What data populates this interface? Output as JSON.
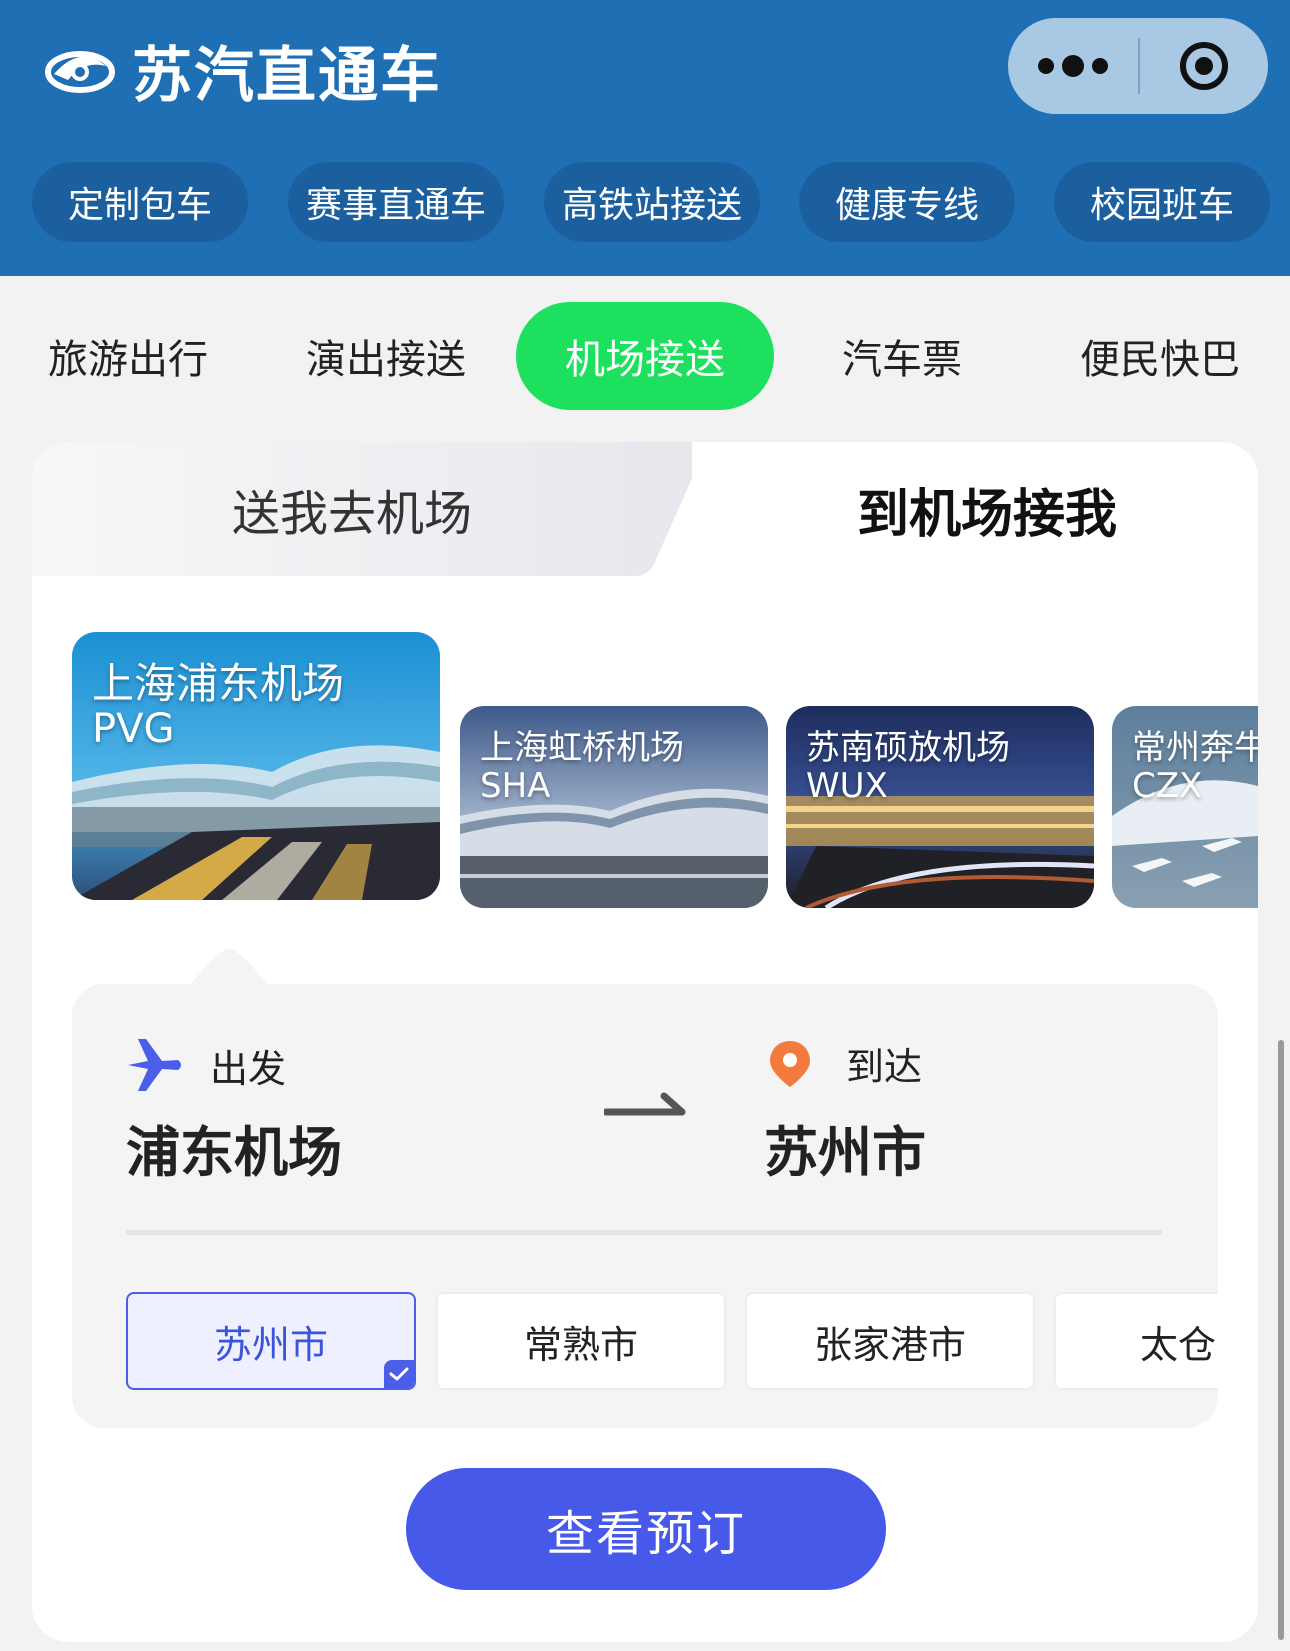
{
  "app": {
    "title": "苏汽直通车"
  },
  "service_tabs": [
    {
      "label": "定制包车"
    },
    {
      "label": "赛事直通车"
    },
    {
      "label": "高铁站接送"
    },
    {
      "label": "健康专线"
    },
    {
      "label": "校园班车"
    }
  ],
  "category_tabs": [
    {
      "label": "旅游出行"
    },
    {
      "label": "演出接送"
    },
    {
      "label": "机场接送",
      "active": true
    },
    {
      "label": "汽车票"
    },
    {
      "label": "便民快巴"
    }
  ],
  "segment": {
    "left_label": "送我去机场",
    "right_label": "到机场接我",
    "selected": "right"
  },
  "airports": [
    {
      "name": "上海浦东机场",
      "code": "PVG",
      "selected": true
    },
    {
      "name": "上海虹桥机场",
      "code": "SHA"
    },
    {
      "name": "苏南硕放机场",
      "code": "WUX"
    },
    {
      "name": "常州奔牛",
      "code": "CZX"
    }
  ],
  "route": {
    "depart_label": "出发",
    "depart_value": "浦东机场",
    "arrive_label": "到达",
    "arrive_value": "苏州市"
  },
  "cities": [
    {
      "label": "苏州市",
      "selected": true
    },
    {
      "label": "常熟市"
    },
    {
      "label": "张家港市"
    },
    {
      "label": "太仓"
    }
  ],
  "cta": {
    "label": "查看预订"
  },
  "colors": {
    "header": "#1f6fb5",
    "active_tab": "#1ee05f",
    "primary": "#4659e9",
    "depart_icon": "#4a5ee8",
    "arrive_icon": "#f47b3d"
  }
}
